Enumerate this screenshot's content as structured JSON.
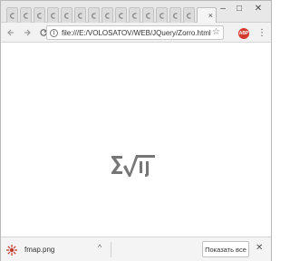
{
  "browser": {
    "tab_count_inactive": 14,
    "active_tab_close": "×",
    "window_controls": {
      "minimize": "–",
      "maximize": "□",
      "close": "✕"
    }
  },
  "toolbar": {
    "back_icon": "arrow-left-icon",
    "forward_icon": "arrow-right-icon",
    "reload_icon": "reload-icon",
    "url": "file:///E:/VOLOSATOV/WEB/JQuery/Zorro.html",
    "info_icon_glyph": "i",
    "star_icon": "star-icon",
    "extension_badge": "ABP",
    "menu_icon": "more-vert-icon"
  },
  "page": {
    "logo_icon": "sigma-sqrt-logo-icon"
  },
  "download_shelf": {
    "file_name": "fmap.png",
    "file_icon_color": "#c0392b",
    "caret": "^",
    "show_all_label": "Показать все",
    "close": "✕"
  }
}
